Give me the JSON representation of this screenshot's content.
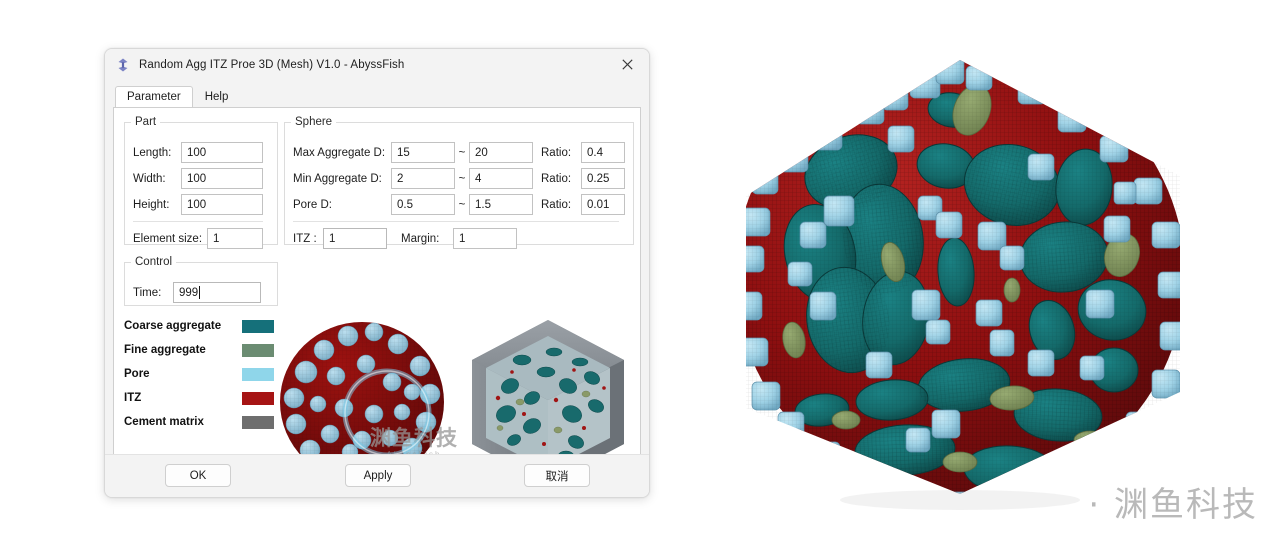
{
  "window": {
    "title": "Random Agg ITZ Proe 3D (Mesh) V1.0 - AbyssFish",
    "icon": "app-diamond-icon",
    "close_label": "×"
  },
  "tabs": [
    {
      "label": "Parameter",
      "active": true
    },
    {
      "label": "Help",
      "active": false
    }
  ],
  "part": {
    "legend": "Part",
    "length_label": "Length:",
    "length_value": "100",
    "width_label": "Width:",
    "width_value": "100",
    "height_label": "Height:",
    "height_value": "100",
    "element_size_label": "Element size:",
    "element_size_value": "1"
  },
  "sphere": {
    "legend": "Sphere",
    "tilde": "~",
    "ratio_label": "Ratio:",
    "rows": [
      {
        "label": "Max Aggregate D:",
        "min": "15",
        "max": "20",
        "ratio": "0.4"
      },
      {
        "label": "Min  Aggregate D:",
        "min": "2",
        "max": "4",
        "ratio": "0.25"
      },
      {
        "label": "Pore D:",
        "min": "0.5",
        "max": "1.5",
        "ratio": "0.01"
      }
    ],
    "itz_label": "ITZ :",
    "itz_value": "1",
    "margin_label": "Margin:",
    "margin_value": "1"
  },
  "control": {
    "legend": "Control",
    "time_label": "Time:",
    "time_value": "999"
  },
  "legend_items": [
    {
      "label": "Coarse aggregate",
      "color": "#15707a"
    },
    {
      "label": "Fine aggregate",
      "color": "#6b8c72"
    },
    {
      "label": "Pore",
      "color": "#8fd6ea"
    },
    {
      "label": "ITZ",
      "color": "#a61414"
    },
    {
      "label": "Cement matrix",
      "color": "#6e6e6e"
    }
  ],
  "buttons": [
    {
      "label": "OK",
      "name": "ok-button"
    },
    {
      "label": "Apply",
      "name": "apply-button"
    },
    {
      "label": "取消",
      "name": "cancel-button"
    }
  ],
  "previews": {
    "left_name": "aggregate-sphere-preview",
    "right_name": "mesh-cube-section-preview"
  },
  "watermarks": {
    "viewport_text": "· 渊鱼科技",
    "inner_cn": "渊鱼科技",
    "inner_en": "AbyssFish"
  },
  "model": {
    "name": "random-aggregate-itz-3d-model",
    "colors": {
      "itz": "#8e0f10",
      "itz_dark": "#6d0b0c",
      "itz_light": "#ad1a18",
      "coarse": "#146a6a",
      "coarse_dark": "#0e4c4c",
      "fine": "#7f935d",
      "pore": "#9fd2e6",
      "pore_dark": "#79b4cd"
    }
  }
}
